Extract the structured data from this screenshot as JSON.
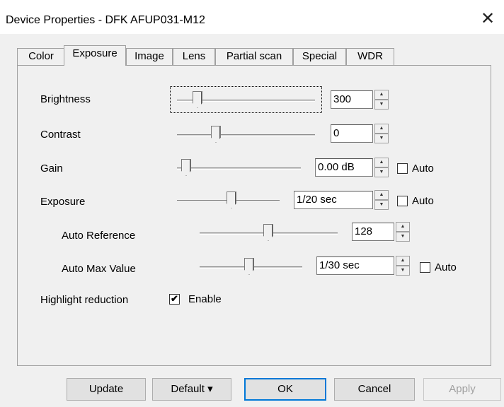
{
  "window": {
    "title": "Device Properties - DFK AFUP031-M12",
    "close_glyph": "✕"
  },
  "tabs": [
    {
      "label": "Color"
    },
    {
      "label": "Exposure",
      "active": true
    },
    {
      "label": "Image"
    },
    {
      "label": "Lens"
    },
    {
      "label": "Partial scan"
    },
    {
      "label": "Special"
    },
    {
      "label": "WDR"
    }
  ],
  "controls": {
    "brightness": {
      "label": "Brightness",
      "value": "300"
    },
    "contrast": {
      "label": "Contrast",
      "value": "0"
    },
    "gain": {
      "label": "Gain",
      "value": "0.00 dB",
      "auto_label": "Auto",
      "auto": false
    },
    "exposure": {
      "label": "Exposure",
      "value": "1/20 sec",
      "auto_label": "Auto",
      "auto": false
    },
    "auto_reference": {
      "label": "Auto Reference",
      "value": "128"
    },
    "auto_max_value": {
      "label": "Auto Max Value",
      "value": "1/30 sec",
      "auto_label": "Auto",
      "auto": false
    },
    "highlight_reduction": {
      "label": "Highlight reduction",
      "enable_label": "Enable",
      "checked_glyph": "✔"
    }
  },
  "spin_glyphs": {
    "up": "▲",
    "down": "▼"
  },
  "buttons": {
    "update": "Update",
    "default": "Default ▾",
    "ok": "OK",
    "cancel": "Cancel",
    "apply": "Apply"
  }
}
